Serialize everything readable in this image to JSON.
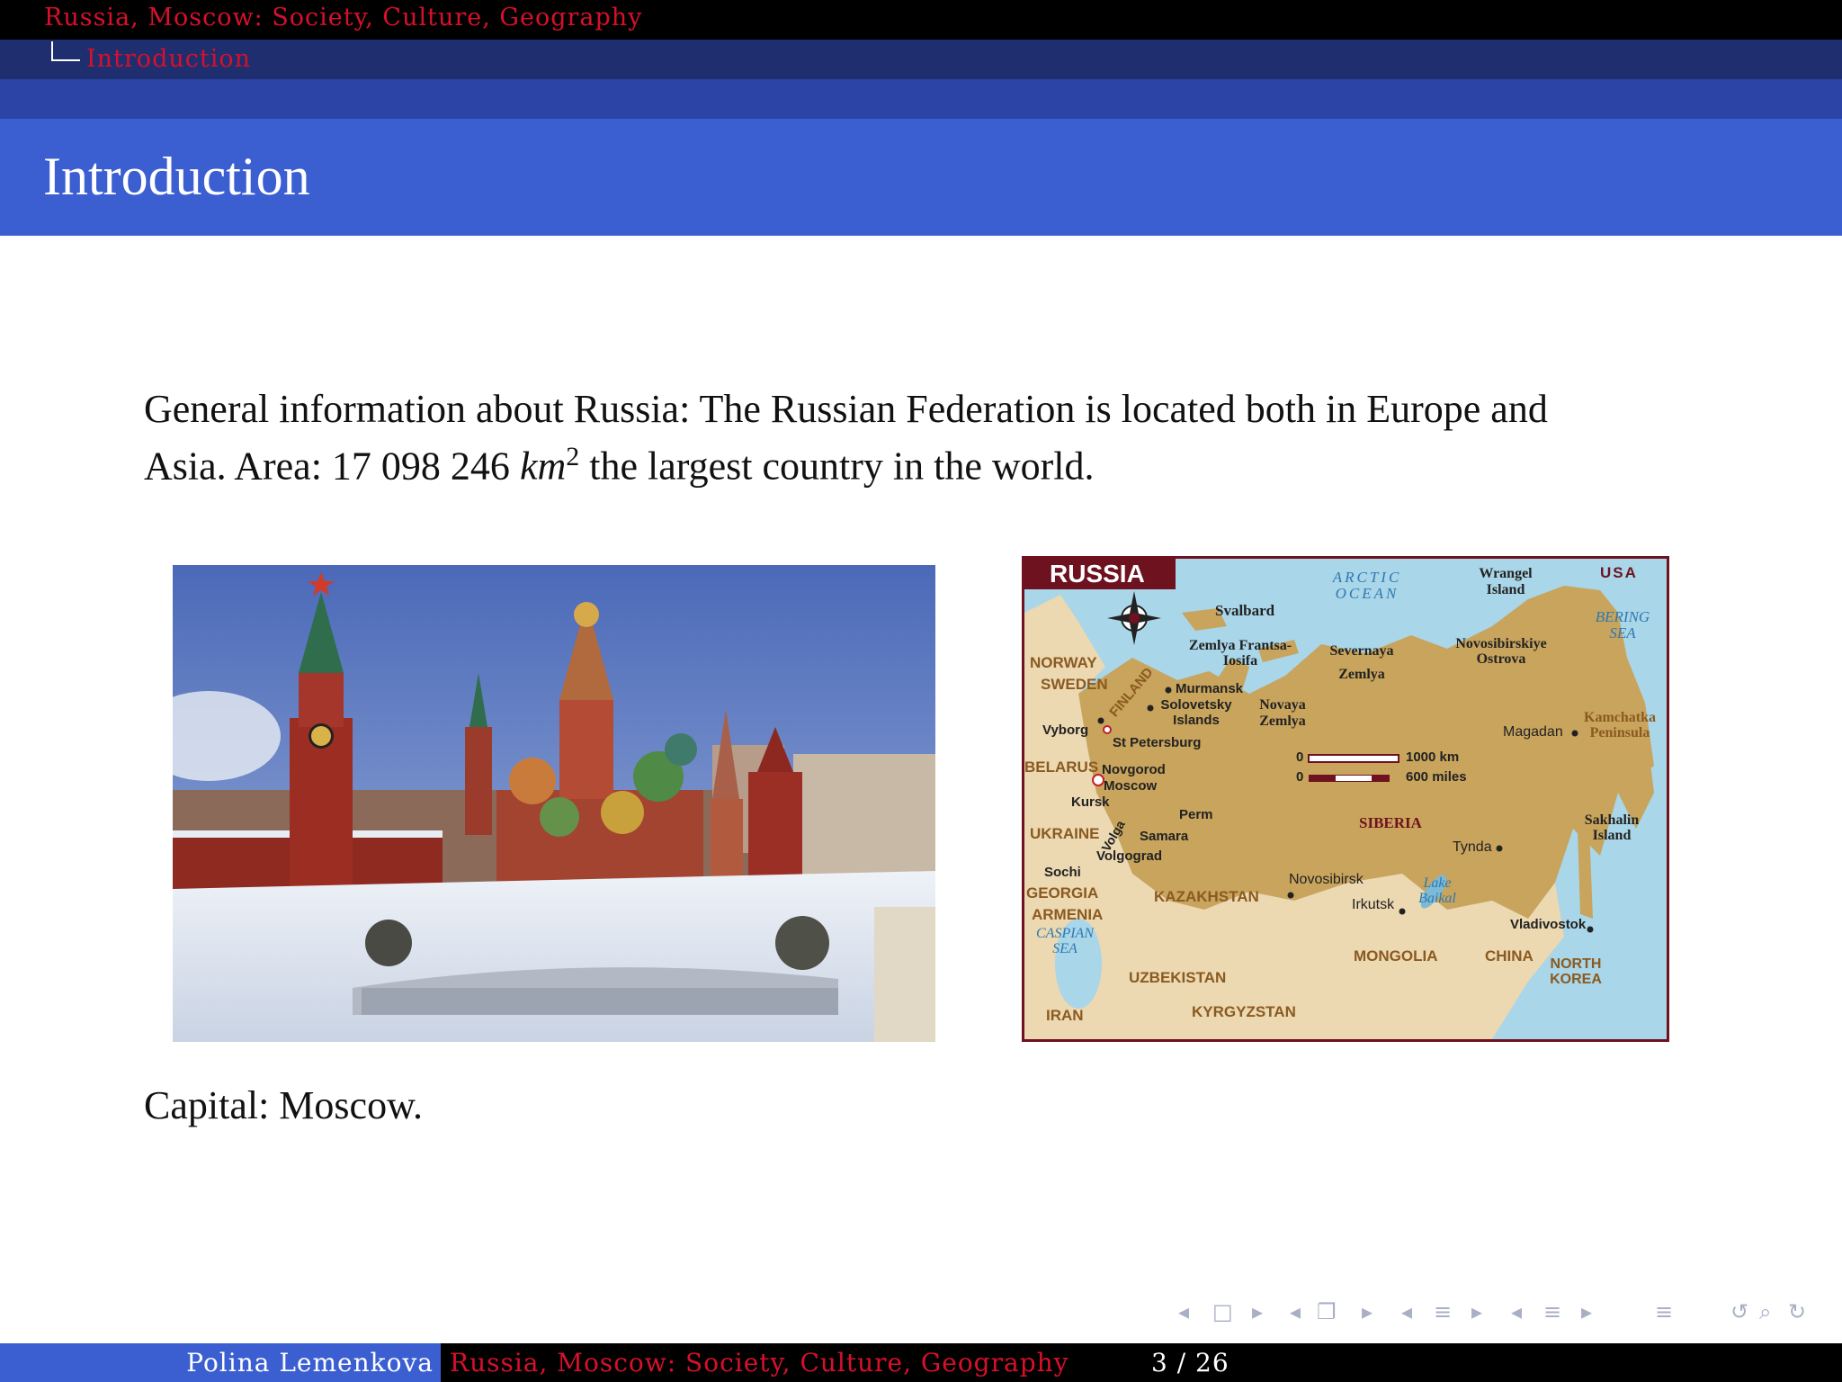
{
  "header": {
    "section_title": "Russia, Moscow: Society, Culture, Geography",
    "subsection_title": "Introduction"
  },
  "frame": {
    "title": "Introduction",
    "paragraph_part1": "General information about Russia: The Russian Federation is located both in Europe and Asia. Area: 17 098 246 ",
    "paragraph_unit": "km",
    "paragraph_sup": "2",
    "paragraph_part2": " the largest country in the world.",
    "capital_text": "Capital: Moscow."
  },
  "map": {
    "title": "RUSSIA",
    "labels": {
      "arctic": "ARCTIC OCEAN",
      "usa": "USA",
      "bering": "BERING SEA",
      "svalbard": "Svalbard",
      "wrangel": "Wrangel Island",
      "zemlya_fi": "Zemlya Frantsa-Iosifa",
      "severnaya": "Severnaya Zemlya",
      "novosibirskiye": "Novosibirskiye Ostrova",
      "norway": "NORWAY",
      "sweden": "SWEDEN",
      "finland": "FINLAND",
      "murmansk": "Murmansk",
      "solovetsky": "Solovetsky Islands",
      "novaya": "Novaya Zemlya",
      "vyborg": "Vyborg",
      "stpetersburg": "St Petersburg",
      "belarus": "BELARUS",
      "novgorod": "Novgorod",
      "moscow": "Moscow",
      "kursk": "Kursk",
      "ukraine": "UKRAINE",
      "volga": "Volga",
      "perm": "Perm",
      "samara": "Samara",
      "volgograd": "Volgograd",
      "sochi": "Sochi",
      "georgia": "GEORGIA",
      "armenia": "ARMENIA",
      "caspian": "CASPIAN SEA",
      "iran": "IRAN",
      "kazakhstan": "KAZAKHSTAN",
      "uzbekistan": "UZBEKISTAN",
      "kyrgyzstan": "KYRGYZSTAN",
      "siberia": "SIBERIA",
      "novosibirsk": "Novosibirsk",
      "irkutsk": "Irkutsk",
      "lake_baikal": "Lake Baikal",
      "mongolia": "MONGOLIA",
      "china": "CHINA",
      "north_korea": "NORTH KOREA",
      "vladivostok": "Vladivostok",
      "tynda": "Tynda",
      "magadan": "Magadan",
      "kamchatka": "Kamchatka Peninsula",
      "sakhalin": "Sakhalin Island",
      "scale_zero": "0",
      "scale_km": "1000 km",
      "scale_miles": "600 miles"
    }
  },
  "footer": {
    "author": "Polina Lemenkova",
    "title": "Russia, Moscow: Society, Culture, Geography",
    "page": "3 / 26"
  },
  "nav_icons": [
    "nav-prev-frame-icon",
    "nav-frame-icon",
    "nav-next-frame-icon",
    "nav-prev-subsection-icon",
    "nav-subsection-icon",
    "nav-next-subsection-icon",
    "nav-prev-section-icon",
    "nav-section-icon",
    "nav-next-section-icon",
    "nav-prev-doc-icon",
    "nav-doc-icon",
    "nav-next-doc-icon",
    "nav-outline-icon",
    "nav-back-icon",
    "nav-search-icon",
    "nav-forward-icon"
  ]
}
